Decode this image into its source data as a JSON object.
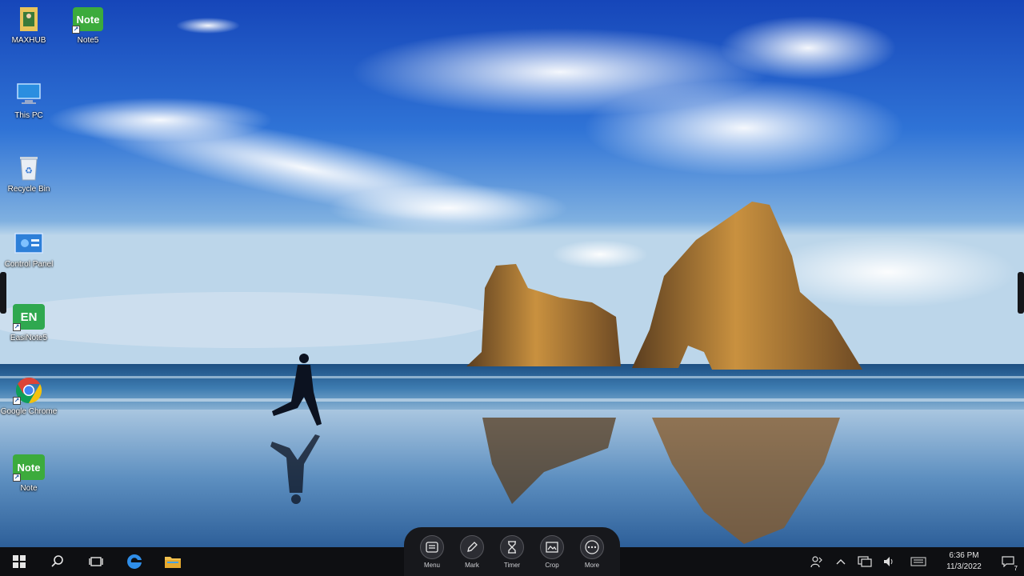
{
  "desktop": {
    "icons": [
      {
        "label": "MAXHUB",
        "icon": "maxhub-folder-icon"
      },
      {
        "label": "Note5",
        "icon": "note5-app-icon"
      },
      {
        "label": "This PC",
        "icon": "this-pc-icon"
      },
      {
        "label": "Recycle Bin",
        "icon": "recycle-bin-icon"
      },
      {
        "label": "Control Panel",
        "icon": "control-panel-icon"
      },
      {
        "label": "EasiNote5",
        "icon": "easinote-app-icon"
      },
      {
        "label": "Google Chrome",
        "icon": "chrome-icon"
      },
      {
        "label": "Note",
        "icon": "note-app-icon"
      }
    ],
    "note5_tile_text": "Note",
    "easinote_tile_text": "EN",
    "note_tile_text": "Note"
  },
  "floating_toolbar": {
    "items": [
      {
        "label": "Menu",
        "icon": "menu-icon"
      },
      {
        "label": "Mark",
        "icon": "pen-mark-icon"
      },
      {
        "label": "Timer",
        "icon": "hourglass-icon"
      },
      {
        "label": "Crop",
        "icon": "screenshot-crop-icon"
      },
      {
        "label": "More",
        "icon": "more-icon"
      }
    ]
  },
  "taskbar": {
    "start": "windows-start-icon",
    "search": "search-icon",
    "task_view": "task-view-icon",
    "pinned": [
      "edge-browser-icon",
      "file-explorer-icon"
    ]
  },
  "tray": {
    "time": "6:36 PM",
    "date": "11/3/2022",
    "notification_badge": "7"
  },
  "colors": {
    "taskbar_bg": "#0e0f12",
    "chrome_red": "#db4437",
    "chrome_yellow": "#f4c20d",
    "chrome_green": "#0f9d58",
    "chrome_blue": "#4285f4",
    "note_green": "#3cab3c"
  }
}
